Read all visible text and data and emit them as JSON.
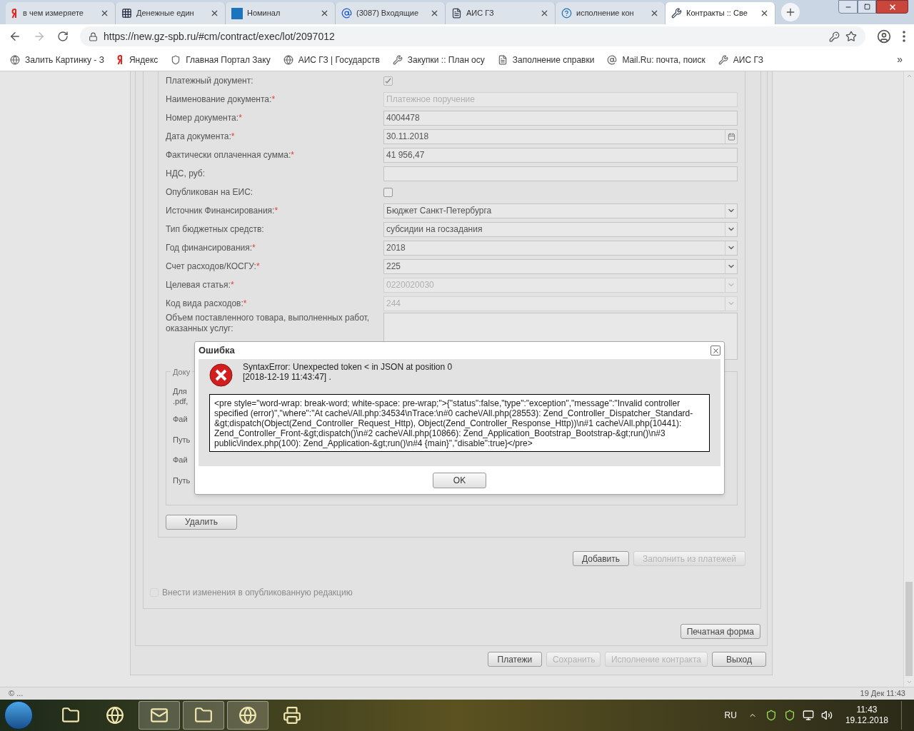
{
  "browser": {
    "tabs": [
      {
        "title": "в чем измеряете",
        "selected": false
      },
      {
        "title": "Денежные един",
        "selected": false
      },
      {
        "title": "Номинал",
        "selected": false
      },
      {
        "title": "(3087) Входящие",
        "selected": false
      },
      {
        "title": "АИС ГЗ",
        "selected": false
      },
      {
        "title": "исполнение кон",
        "selected": false
      },
      {
        "title": "Контракты :: Све",
        "selected": true
      }
    ],
    "url": "https://new.gz-spb.ru/#cm/contract/exec/lot/2097012",
    "bookmarks": [
      "Залить Картинку - З",
      "Яндекс",
      "Главная Портал Заку",
      "АИС ГЗ | Государств",
      "Закупки :: План осу",
      "Заполнение справки",
      "Mail.Ru: почта, поиск",
      "АИС ГЗ"
    ],
    "bookmarks_more": "»"
  },
  "form": {
    "rows": [
      {
        "label": "Платежный документ:",
        "kind": "checkbox",
        "disabled": true,
        "checked": true
      },
      {
        "label": "Наименование документа:",
        "kind": "text",
        "required_mark": "*",
        "disabled": true,
        "value": "Платежное поручение"
      },
      {
        "label": "Номер документа:",
        "kind": "text",
        "required_mark": "*",
        "disabled": false,
        "value": "4004478"
      },
      {
        "label": "Дата документа:",
        "kind": "date",
        "required_mark": "*",
        "disabled": false,
        "value": "30.11.2018"
      },
      {
        "label": "Фактически оплаченная сумма:",
        "kind": "text",
        "required_mark": "*",
        "disabled": false,
        "value": "41 956,47"
      },
      {
        "label": "НДС, руб:",
        "kind": "text",
        "disabled": false
      },
      {
        "label": "Опубликован на ЕИС:",
        "kind": "checkbox",
        "disabled": false,
        "checked": false
      },
      {
        "label": "Источник Финансирования:",
        "kind": "select",
        "required_mark": "*",
        "disabled": false,
        "value": "Бюджет Санкт-Петербурга"
      },
      {
        "label": "Тип бюджетных средств:",
        "kind": "select",
        "disabled": false,
        "value": "субсидии на госзадания"
      },
      {
        "label": "Год финансирования:",
        "kind": "select",
        "required_mark": "*",
        "disabled": false,
        "value": "2018"
      },
      {
        "label": "Счет расходов/КОСГУ:",
        "kind": "select",
        "required_mark": "*",
        "disabled": false,
        "value": "225"
      },
      {
        "label": "Целевая статья:",
        "kind": "select",
        "required_mark": "*",
        "disabled": true,
        "value": "0220020030"
      },
      {
        "label": "Код вида расходов:",
        "kind": "select",
        "required_mark": "*",
        "disabled": true,
        "value": "244"
      },
      {
        "label": "Объем поставленного товара, выполненных работ, оказанных услуг:",
        "kind": "textarea"
      }
    ],
    "documents": {
      "legend": "Доку",
      "hint_lines": [
        "Для",
        ".pdf,"
      ],
      "fields": [
        "Фай",
        "Путь",
        "Фай",
        "Путь"
      ],
      "delete_button": "Удалить"
    },
    "actions": [
      {
        "label": "Добавить",
        "disabled": false
      },
      {
        "label": "Заполнить из платежей",
        "disabled": true
      }
    ],
    "publish_checkbox": {
      "label": "Внести изменения в опубликованную редакцию",
      "checked": false,
      "disabled": true
    },
    "print_button": "Печатная форма",
    "footer_buttons": [
      {
        "label": "Платежи",
        "disabled": false
      },
      {
        "label": "Сохранить",
        "disabled": true
      },
      {
        "label": "Исполнение контракта",
        "disabled": true
      },
      {
        "label": "Выход",
        "disabled": false
      }
    ]
  },
  "dialog": {
    "title": "Ошибка",
    "message": [
      "SyntaxError: Unexpected token < in JSON at position 0",
      "[2018-12-19 11:43:47] ."
    ],
    "details": "<pre style=\"word-wrap: break-word; white-space: pre-wrap;\">{\"status\":false,\"type\":\"exception\",\"message\":\"Invalid controller specified (error)\",\"where\":\"At cache\\/All.php:34534\\nTrace:\\n#0 cache\\/All.php(28553): Zend_Controller_Dispatcher_Standard-&gt;dispatch(Object(Zend_Controller_Request_Http), Object(Zend_Controller_Response_Http))\\n#1 cache\\/All.php(10441): Zend_Controller_Front-&gt;dispatch()\\n#2 cache\\/All.php(10866): Zend_Application_Bootstrap_Bootstrap-&gt;run()\\n#3 public\\/index.php(100): Zend_Application-&gt;run()\\n#4 {main}\",\"disable\":true}</pre>",
    "ok_button": "OK"
  },
  "status_bar": {
    "left": "© ...",
    "right": "19 Дек 11:43"
  },
  "taskbar": {
    "apps": [
      {
        "open": false
      },
      {
        "open": false
      },
      {
        "open": true
      },
      {
        "open": true
      },
      {
        "open": true
      },
      {
        "open": false
      }
    ],
    "language": "RU",
    "time": "11:43",
    "date": "19.12.2018"
  }
}
